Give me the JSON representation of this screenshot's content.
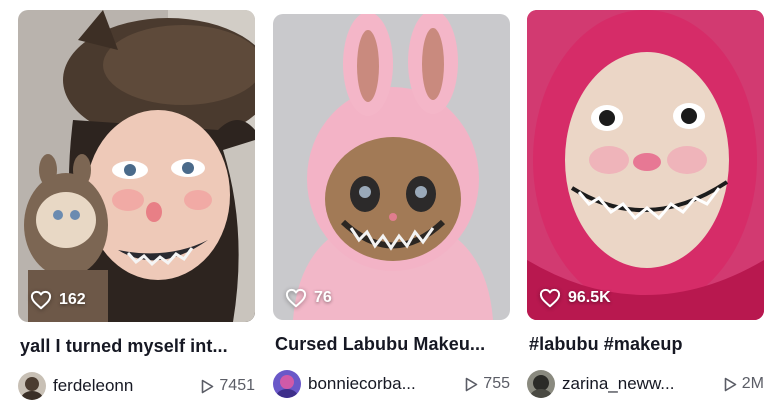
{
  "videos": [
    {
      "likes": "162",
      "title": "yall I turned myself int...",
      "username": "ferdeleonn",
      "views": "7451"
    },
    {
      "likes": "76",
      "title": "Cursed Labubu Makeu...",
      "username": "bonniecorba...",
      "views": "755"
    },
    {
      "likes": "96.5K",
      "title": "#labubu #makeup",
      "username": "zarina_neww...",
      "views": "2M"
    }
  ],
  "icons": {
    "like": "heart-outline-icon",
    "views": "play-outline-icon"
  }
}
